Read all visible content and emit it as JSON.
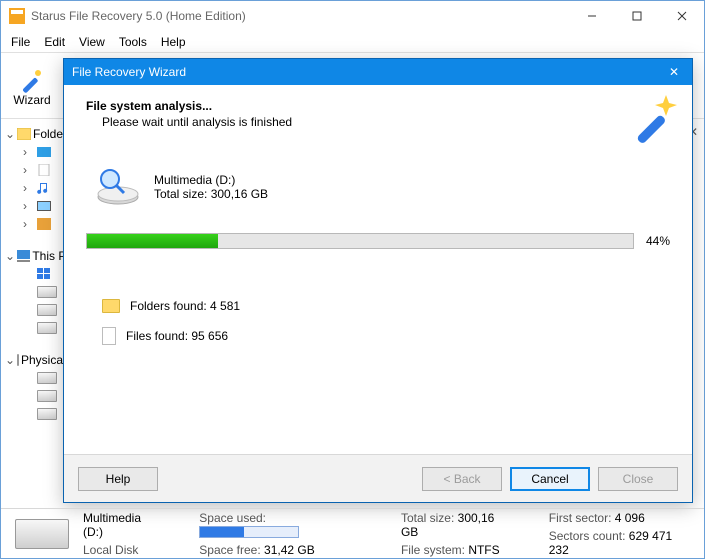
{
  "app": {
    "title": "Starus File Recovery 5.0 (Home Edition)"
  },
  "menu": {
    "file": "File",
    "edit": "Edit",
    "view": "View",
    "tools": "Tools",
    "help": "Help"
  },
  "toolbar": {
    "wizard": "Wizard"
  },
  "tree": {
    "folders": "Folders",
    "thispc": "This PC",
    "physical": "Physical Disks"
  },
  "wizard": {
    "title": "File Recovery Wizard",
    "heading": "File system analysis...",
    "subheading": "Please wait until analysis is finished",
    "disk_name": "Multimedia (D:)",
    "disk_size": "Total size: 300,16 GB",
    "progress_pct": "44%",
    "progress_fill_width": "24%",
    "folders_found": "Folders found: 4 581",
    "files_found": "Files found: 95 656",
    "buttons": {
      "help": "Help",
      "back": "< Back",
      "cancel": "Cancel",
      "close": "Close"
    }
  },
  "status": {
    "disk_name": "Multimedia (D:)",
    "disk_type": "Local Disk",
    "space_used_label": "Space used:",
    "space_used_fill": "45%",
    "space_free_label": "Space free:",
    "space_free_value": "31,42 GB",
    "total_size_label": "Total size:",
    "total_size_value": "300,16 GB",
    "fs_label": "File system:",
    "fs_value": "NTFS",
    "first_sector_label": "First sector:",
    "first_sector_value": "4 096",
    "sectors_count_label": "Sectors count:",
    "sectors_count_value": "629 471 232"
  }
}
